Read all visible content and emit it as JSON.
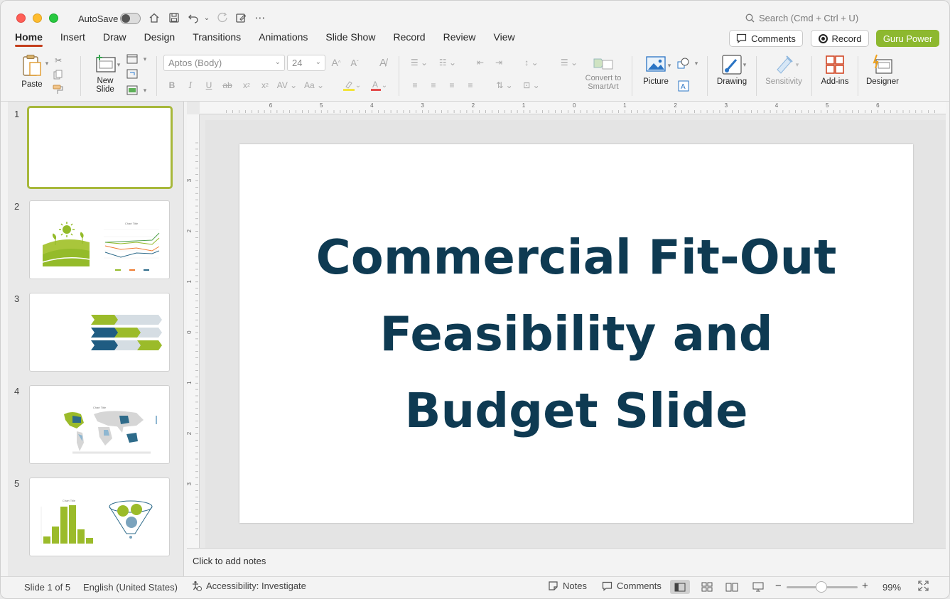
{
  "titlebar": {
    "autosave_label": "AutoSave",
    "search_placeholder": "Search (Cmd + Ctrl + U)"
  },
  "tabs": [
    "Home",
    "Insert",
    "Draw",
    "Design",
    "Transitions",
    "Animations",
    "Slide Show",
    "Record",
    "Review",
    "View"
  ],
  "actions": {
    "comments": "Comments",
    "record": "Record",
    "guru": "Guru Power"
  },
  "ribbon": {
    "paste": "Paste",
    "new_slide_line1": "New",
    "new_slide_line2": "Slide",
    "font_name": "Aptos (Body)",
    "font_size": "24",
    "convert_line1": "Convert to",
    "convert_line2": "SmartArt",
    "picture": "Picture",
    "drawing": "Drawing",
    "sensitivity": "Sensitivity",
    "addins": "Add-ins",
    "designer": "Designer"
  },
  "thumbnails": [
    {
      "num": "1"
    },
    {
      "num": "2",
      "chart_title": "Chart Title"
    },
    {
      "num": "3"
    },
    {
      "num": "4",
      "chart_title": "Chart Title"
    },
    {
      "num": "5",
      "chart_title": "Chart Title"
    }
  ],
  "ruler": {
    "h_labels": [
      "6",
      "5",
      "4",
      "3",
      "2",
      "1",
      "0",
      "1",
      "2",
      "3",
      "4",
      "5",
      "6"
    ],
    "v_labels": [
      "3",
      "2",
      "1",
      "0",
      "1",
      "2",
      "3"
    ]
  },
  "slide": {
    "title_line1": "Commercial Fit-Out",
    "title_line2": "Feasibility and",
    "title_line3": "Budget Slide"
  },
  "notes_placeholder": "Click to add notes",
  "status": {
    "slide_count": "Slide 1 of 5",
    "language": "English (United States)",
    "accessibility": "Accessibility: Investigate",
    "notes": "Notes",
    "comments": "Comments",
    "zoom": "99%"
  },
  "colors": {
    "title": "#0e3a52",
    "accent_green": "#8db82f",
    "tab_underline": "#c43e1c"
  }
}
